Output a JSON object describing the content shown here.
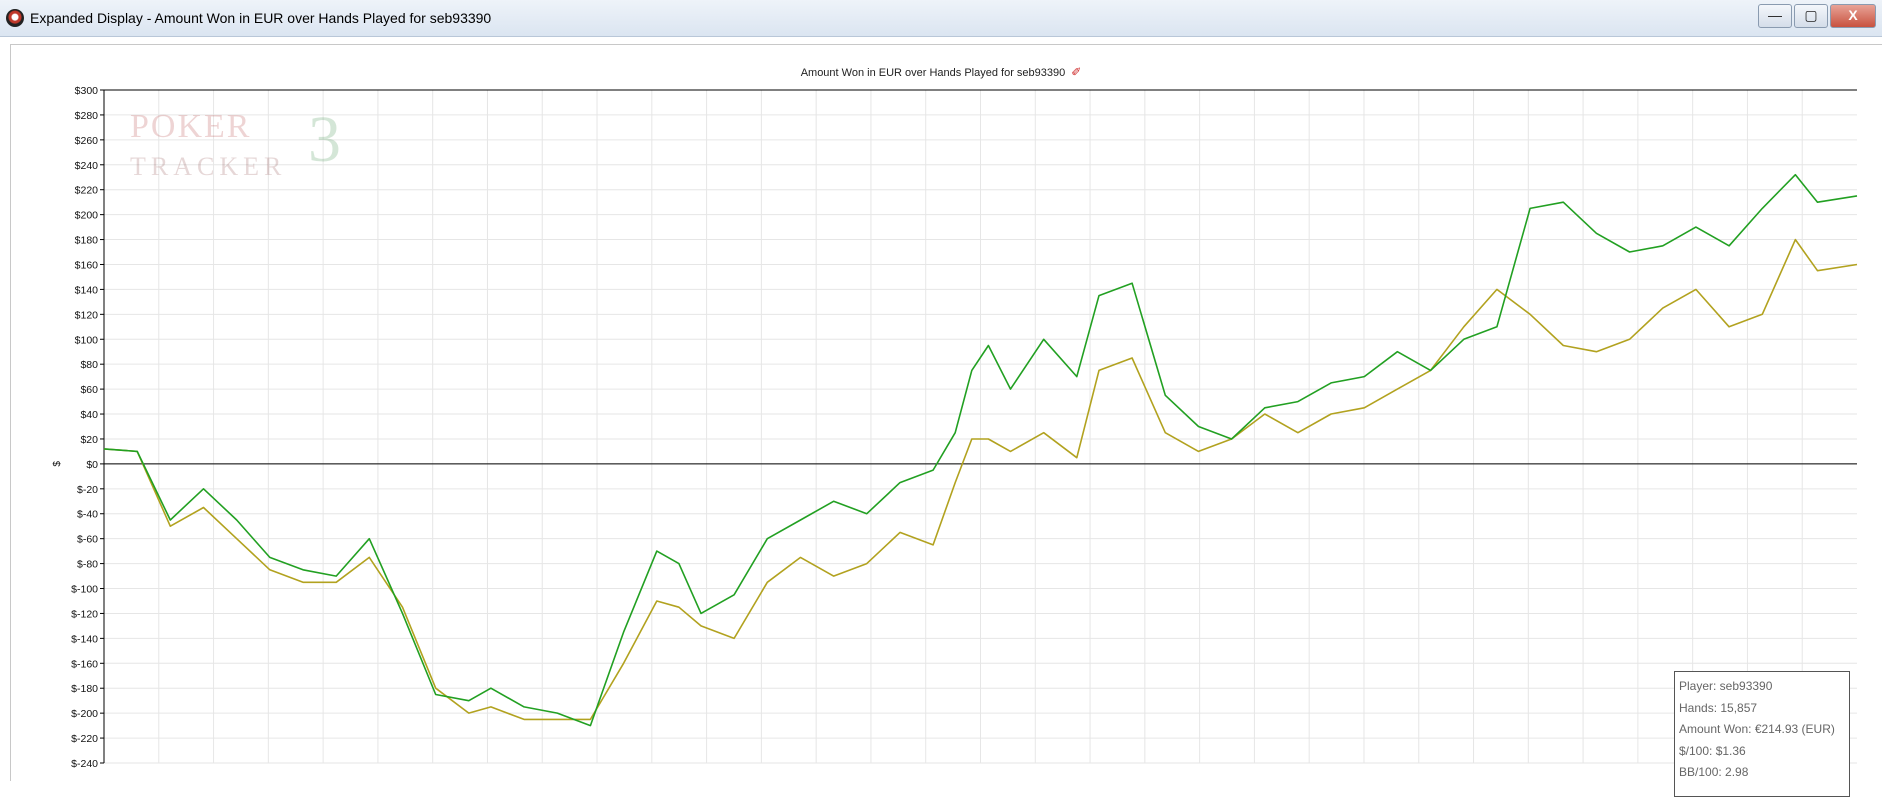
{
  "window": {
    "title": "Expanded Display - Amount Won in EUR over Hands Played for seb93390",
    "minimize": "—",
    "maximize": "▢",
    "close": "X"
  },
  "watermark": {
    "line1": "POKER",
    "line2": "TRACKER",
    "mark": "3"
  },
  "stats": {
    "player": "Player: seb93390",
    "hands": "Hands: 15,857",
    "amount_won": "Amount Won: €214.93 (EUR)",
    "dollar_per_100": "$/100: $1.36",
    "bb_per_100": "BB/100: 2.98"
  },
  "colors": {
    "green": "#22a022",
    "olive": "#b2a21f",
    "grid": "#e6e6e6",
    "axis": "#000000"
  },
  "chart_data": {
    "type": "line",
    "title": "Amount Won in EUR over Hands Played for seb93390",
    "ylabel": "$",
    "xlabel": "",
    "ylim": [
      -240,
      300
    ],
    "y_ticks": [
      {
        "v": 300,
        "label": "$300"
      },
      {
        "v": 280,
        "label": "$280"
      },
      {
        "v": 260,
        "label": "$260"
      },
      {
        "v": 240,
        "label": "$240"
      },
      {
        "v": 220,
        "label": "$220"
      },
      {
        "v": 200,
        "label": "$200"
      },
      {
        "v": 180,
        "label": "$180"
      },
      {
        "v": 160,
        "label": "$160"
      },
      {
        "v": 140,
        "label": "$140"
      },
      {
        "v": 120,
        "label": "$120"
      },
      {
        "v": 100,
        "label": "$100"
      },
      {
        "v": 80,
        "label": "$80"
      },
      {
        "v": 60,
        "label": "$60"
      },
      {
        "v": 40,
        "label": "$40"
      },
      {
        "v": 20,
        "label": "$20"
      },
      {
        "v": 0,
        "label": "$0"
      },
      {
        "v": -20,
        "label": "$-20"
      },
      {
        "v": -40,
        "label": "$-40"
      },
      {
        "v": -60,
        "label": "$-60"
      },
      {
        "v": -80,
        "label": "$-80"
      },
      {
        "v": -100,
        "label": "$-100"
      },
      {
        "v": -120,
        "label": "$-120"
      },
      {
        "v": -140,
        "label": "$-140"
      },
      {
        "v": -160,
        "label": "$-160"
      },
      {
        "v": -180,
        "label": "$-180"
      },
      {
        "v": -200,
        "label": "$-200"
      },
      {
        "v": -220,
        "label": "$-220"
      },
      {
        "v": -240,
        "label": "$-240"
      }
    ],
    "xlim": [
      0,
      15857
    ],
    "grid": true,
    "series": [
      {
        "key": "amount_won",
        "color": "#22a022",
        "x": [
          0,
          300,
          600,
          900,
          1200,
          1500,
          1800,
          2100,
          2400,
          2700,
          3000,
          3300,
          3500,
          3800,
          4100,
          4400,
          4700,
          5000,
          5200,
          5400,
          5700,
          6000,
          6300,
          6600,
          6900,
          7200,
          7500,
          7700,
          7850,
          8000,
          8200,
          8500,
          8800,
          9000,
          9300,
          9600,
          9900,
          10200,
          10500,
          10800,
          11100,
          11400,
          11700,
          12000,
          12300,
          12600,
          12900,
          13200,
          13500,
          13800,
          14100,
          14400,
          14700,
          15000,
          15300,
          15500,
          15857
        ],
        "y": [
          12,
          10,
          -45,
          -20,
          -45,
          -75,
          -85,
          -90,
          -60,
          -120,
          -185,
          -190,
          -180,
          -195,
          -200,
          -210,
          -135,
          -70,
          -80,
          -120,
          -105,
          -60,
          -45,
          -30,
          -40,
          -15,
          -5,
          25,
          75,
          95,
          60,
          100,
          70,
          135,
          145,
          55,
          30,
          20,
          45,
          50,
          65,
          70,
          90,
          75,
          100,
          110,
          205,
          210,
          185,
          170,
          175,
          190,
          175,
          205,
          232,
          210,
          215
        ]
      },
      {
        "key": "amount_won_alt",
        "color": "#b2a21f",
        "x": [
          0,
          300,
          600,
          900,
          1200,
          1500,
          1800,
          2100,
          2400,
          2700,
          3000,
          3300,
          3500,
          3800,
          4100,
          4400,
          4700,
          5000,
          5200,
          5400,
          5700,
          6000,
          6300,
          6600,
          6900,
          7200,
          7500,
          7700,
          7850,
          8000,
          8200,
          8500,
          8800,
          9000,
          9300,
          9600,
          9900,
          10200,
          10500,
          10800,
          11100,
          11400,
          11700,
          12000,
          12300,
          12600,
          12900,
          13200,
          13500,
          13800,
          14100,
          14400,
          14700,
          15000,
          15300,
          15500,
          15857
        ],
        "y": [
          12,
          10,
          -50,
          -35,
          -60,
          -85,
          -95,
          -95,
          -75,
          -115,
          -180,
          -200,
          -195,
          -205,
          -205,
          -205,
          -160,
          -110,
          -115,
          -130,
          -140,
          -95,
          -75,
          -90,
          -80,
          -55,
          -65,
          -15,
          20,
          20,
          10,
          25,
          5,
          75,
          85,
          25,
          10,
          20,
          40,
          25,
          40,
          45,
          60,
          75,
          110,
          140,
          120,
          95,
          90,
          100,
          125,
          140,
          110,
          120,
          180,
          155,
          160
        ]
      }
    ]
  }
}
